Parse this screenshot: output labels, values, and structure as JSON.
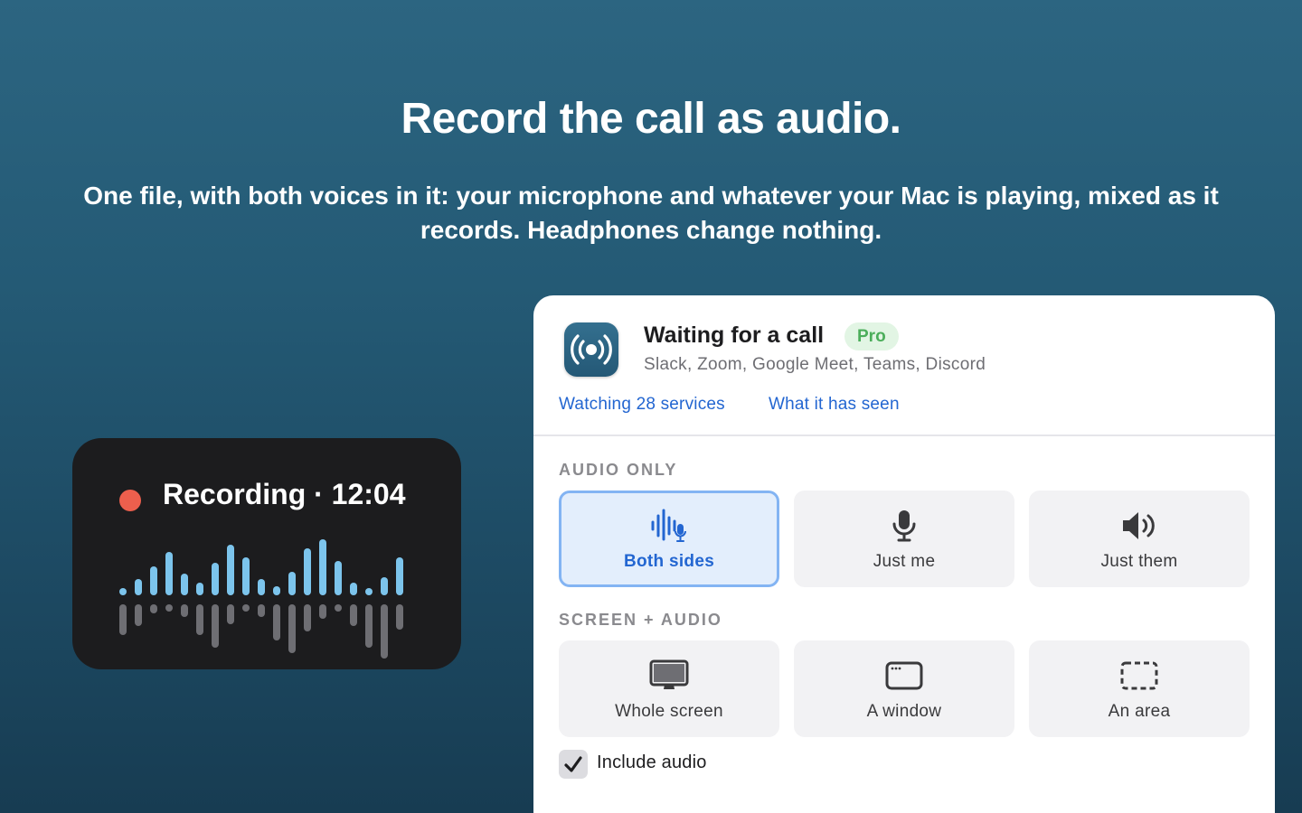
{
  "hero": {
    "title": "Record the call as audio.",
    "subtitle": "One file, with both voices in it: your microphone and whatever your Mac is playing, mixed as it records. Headphones change nothing."
  },
  "recording_widget": {
    "title": "Recording · 12:04",
    "dot_color": "#ec5f4d",
    "wave_colors": {
      "top": "#7cc4ec",
      "bottom": "#6e6e73"
    }
  },
  "panel": {
    "app_icon": "broadcast-icon",
    "status_title": "Waiting for a call",
    "badge": "Pro",
    "services": "Slack, Zoom, Google Meet, Teams, Discord",
    "links": {
      "watching": "Watching 28 services",
      "seen": "What it has seen"
    },
    "audio_only": {
      "label": "AUDIO ONLY",
      "options": [
        {
          "label": "Both sides",
          "icon": "waveform-mic-icon",
          "selected": true
        },
        {
          "label": "Just me",
          "icon": "microphone-icon",
          "selected": false
        },
        {
          "label": "Just them",
          "icon": "speaker-icon",
          "selected": false
        }
      ]
    },
    "screen_audio": {
      "label": "SCREEN + AUDIO",
      "options": [
        {
          "label": "Whole screen",
          "icon": "display-icon"
        },
        {
          "label": "A window",
          "icon": "window-icon"
        },
        {
          "label": "An area",
          "icon": "dashed-area-icon"
        }
      ]
    },
    "include_audio": {
      "label": "Include audio",
      "checked": true
    }
  },
  "colors": {
    "accent": "#2366d1",
    "selected_bg": "#e3eefc",
    "selected_border": "#83b4f3",
    "pro_bg": "#e2f5e4",
    "pro_text": "#4cae5b"
  }
}
